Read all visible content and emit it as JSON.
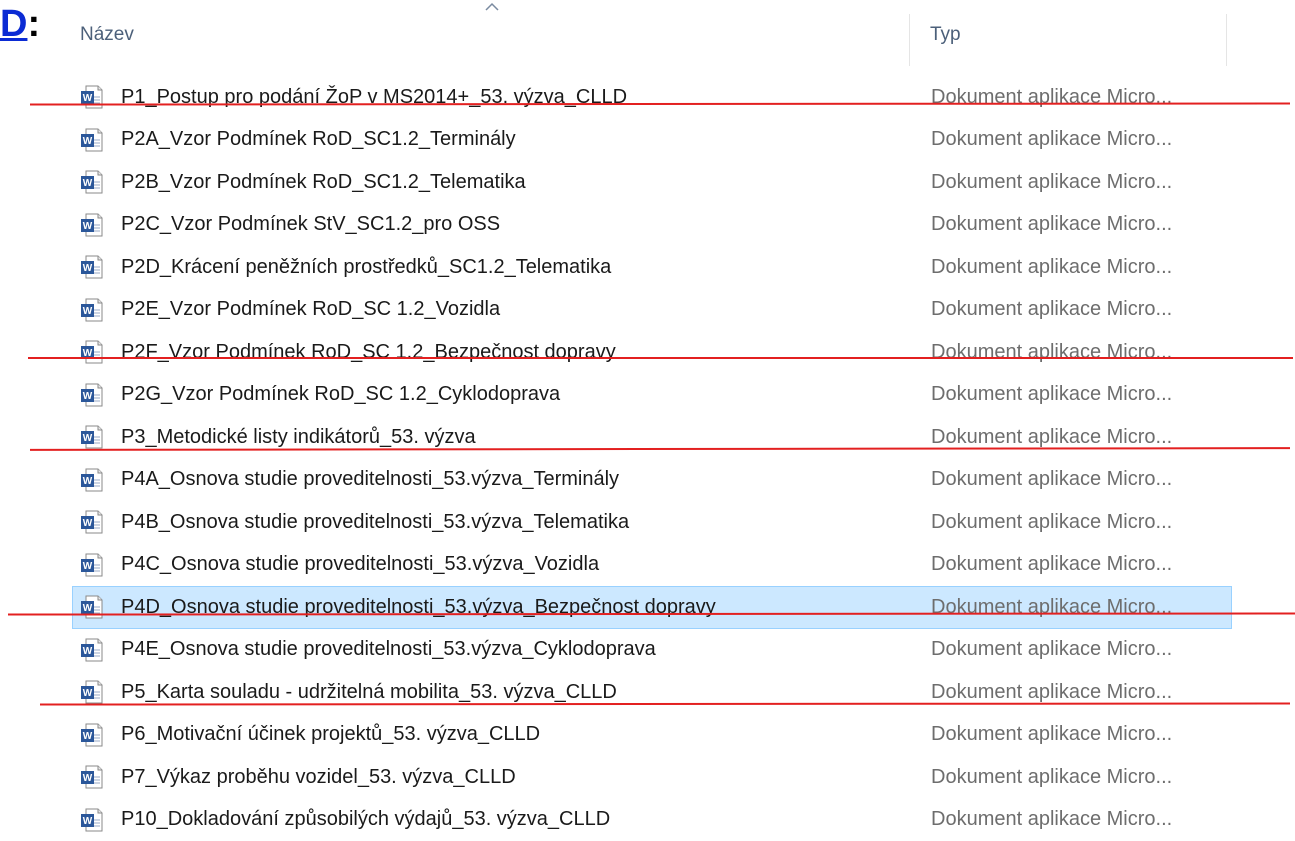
{
  "corner_fragment": {
    "link_text": "D",
    "suffix": ":"
  },
  "columns": {
    "name": "Název",
    "type": "Typ"
  },
  "files": [
    {
      "name": "P1_Postup pro podání ŽoP v MS2014+_53. výzva_CLLD",
      "type": "Dokument aplikace Micro..."
    },
    {
      "name": "P2A_Vzor Podmínek RoD_SC1.2_Terminály",
      "type": "Dokument aplikace Micro..."
    },
    {
      "name": "P2B_Vzor Podmínek RoD_SC1.2_Telematika",
      "type": "Dokument aplikace Micro..."
    },
    {
      "name": "P2C_Vzor Podmínek StV_SC1.2_pro OSS",
      "type": "Dokument aplikace Micro..."
    },
    {
      "name": "P2D_Krácení peněžních prostředků_SC1.2_Telematika",
      "type": "Dokument aplikace Micro..."
    },
    {
      "name": "P2E_Vzor Podmínek RoD_SC 1.2_Vozidla",
      "type": "Dokument aplikace Micro..."
    },
    {
      "name": "P2F_Vzor Podmínek RoD_SC 1.2_Bezpečnost dopravy",
      "type": "Dokument aplikace Micro..."
    },
    {
      "name": "P2G_Vzor Podmínek RoD_SC 1.2_Cyklodoprava",
      "type": "Dokument aplikace Micro..."
    },
    {
      "name": "P3_Metodické listy indikátorů_53. výzva",
      "type": "Dokument aplikace Micro..."
    },
    {
      "name": "P4A_Osnova studie proveditelnosti_53.výzva_Terminály",
      "type": "Dokument aplikace Micro..."
    },
    {
      "name": "P4B_Osnova studie proveditelnosti_53.výzva_Telematika",
      "type": "Dokument aplikace Micro..."
    },
    {
      "name": "P4C_Osnova studie proveditelnosti_53.výzva_Vozidla",
      "type": "Dokument aplikace Micro..."
    },
    {
      "name": "P4D_Osnova studie proveditelnosti_53.výzva_Bezpečnost dopravy",
      "type": "Dokument aplikace Micro...",
      "selected": true
    },
    {
      "name": "P4E_Osnova studie proveditelnosti_53.výzva_Cyklodoprava",
      "type": "Dokument aplikace Micro..."
    },
    {
      "name": "P5_Karta souladu - udržitelná mobilita_53. výzva_CLLD",
      "type": "Dokument aplikace Micro..."
    },
    {
      "name": "P6_Motivační účinek projektů_53. výzva_CLLD",
      "type": "Dokument aplikace Micro..."
    },
    {
      "name": "P7_Výkaz proběhu vozidel_53. výzva_CLLD",
      "type": "Dokument aplikace Micro..."
    },
    {
      "name": "P10_Dokladování způsobilých výdajů_53. výzva_CLLD",
      "type": "Dokument aplikace Micro..."
    }
  ],
  "colors": {
    "selection_bg": "#cce8ff",
    "selection_border": "#99d1ff",
    "annotation_red": "#e32020",
    "word_icon_blue": "#2b579a"
  },
  "icons": {
    "file_icon": "word-document-icon",
    "sort_indicator": "sort-ascending-caret-icon"
  }
}
